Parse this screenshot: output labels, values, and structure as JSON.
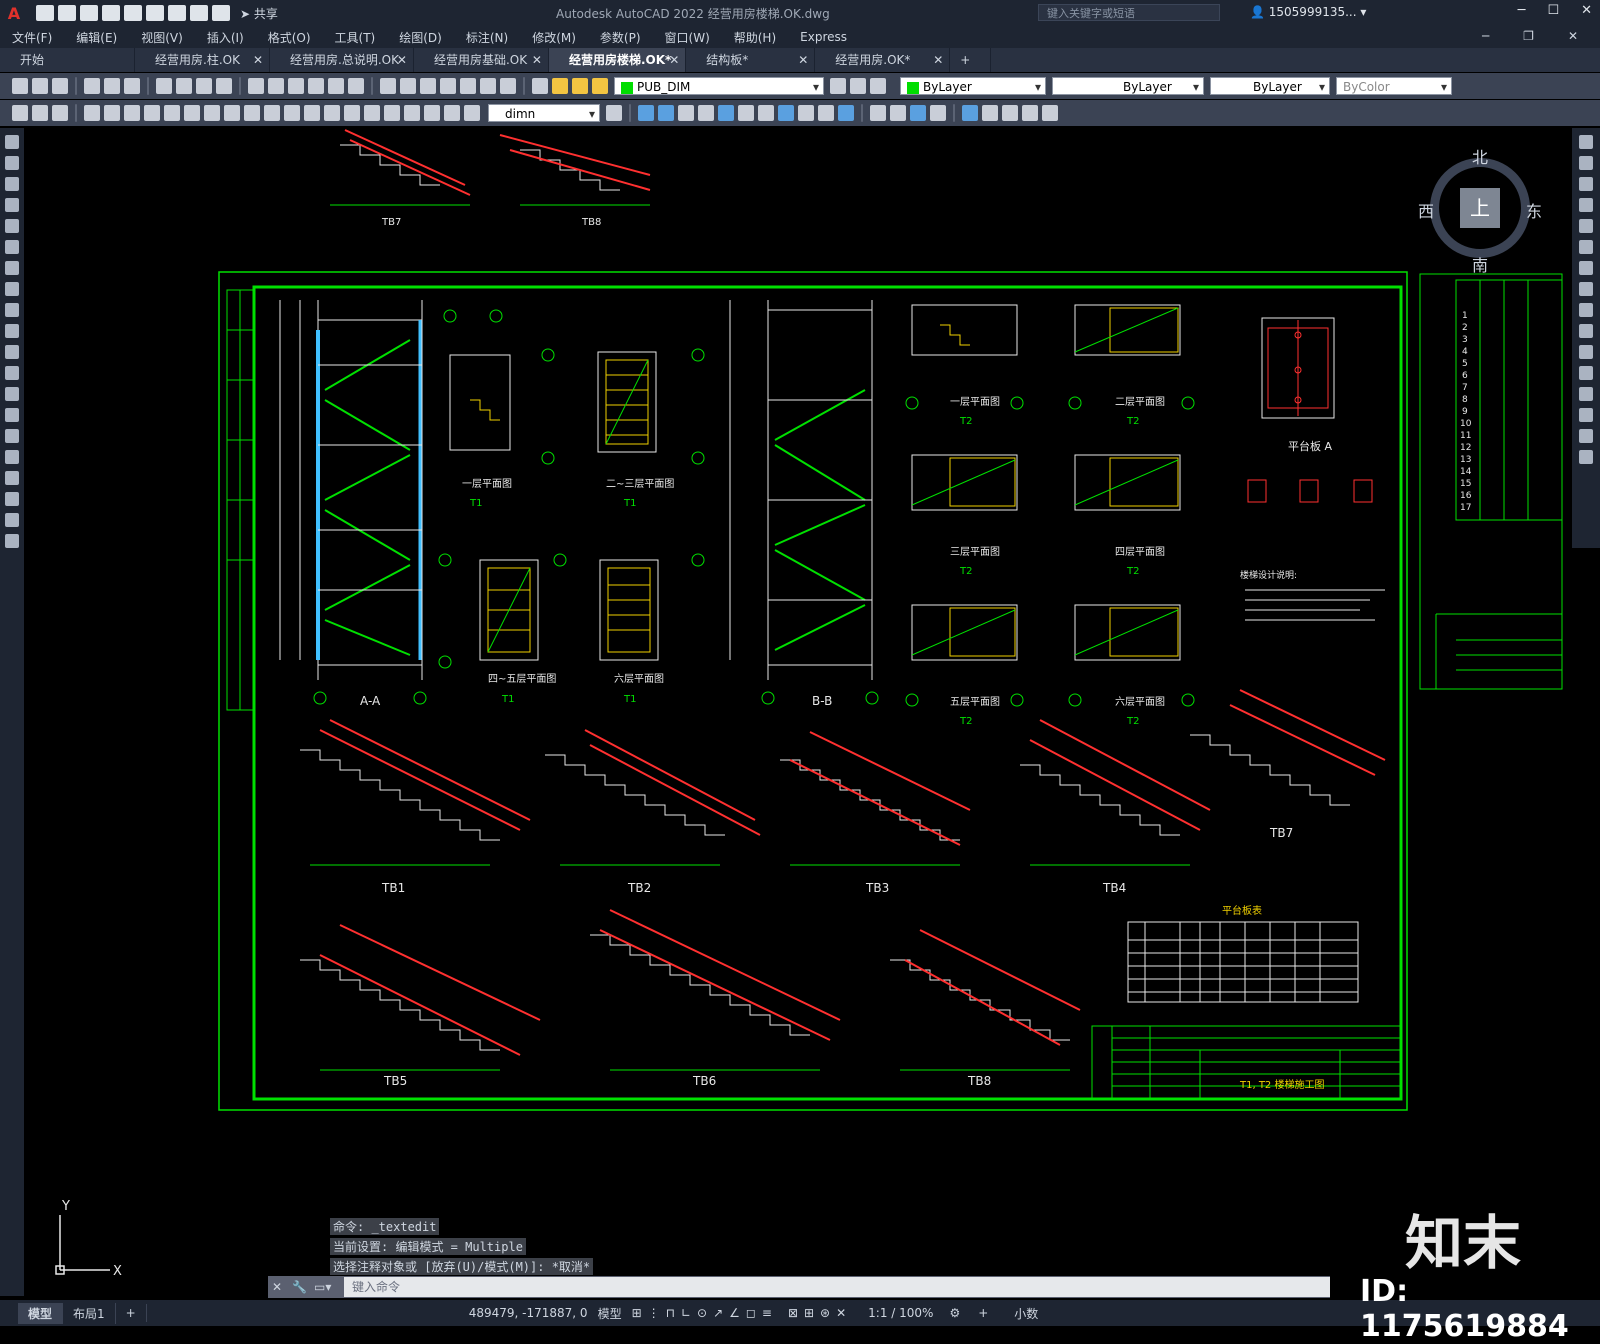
{
  "title_bar": {
    "app_logo": "A",
    "share_label": "共享",
    "app_title": "Autodesk AutoCAD 2022    经营用房楼梯.OK.dwg",
    "search_placeholder": "键入关键字或短语",
    "user_name": "1505999135..."
  },
  "menu": [
    "文件(F)",
    "编辑(E)",
    "视图(V)",
    "插入(I)",
    "格式(O)",
    "工具(T)",
    "绘图(D)",
    "标注(N)",
    "修改(M)",
    "参数(P)",
    "窗口(W)",
    "帮助(H)",
    "Express"
  ],
  "doc_tabs": [
    {
      "label": "开始",
      "closable": false,
      "active": false
    },
    {
      "label": "经营用房.柱.OK",
      "closable": true,
      "active": false
    },
    {
      "label": "经营用房.总说明.OK",
      "closable": true,
      "active": false
    },
    {
      "label": "经营用房基础.OK",
      "closable": true,
      "active": false
    },
    {
      "label": "经营用房楼梯.OK*",
      "closable": true,
      "active": true
    },
    {
      "label": "结构板*",
      "closable": true,
      "active": false
    },
    {
      "label": "经营用房.OK*",
      "closable": true,
      "active": false
    }
  ],
  "toolbar": {
    "layer": "PUB_DIM",
    "color": "ByLayer",
    "linetype": "ByLayer",
    "lineweight": "ByLayer",
    "plotstyle": "ByColor",
    "dimstyle": "dimn"
  },
  "viewcube": {
    "north": "北",
    "south": "南",
    "east": "东",
    "west": "西",
    "face": "上"
  },
  "drawing": {
    "section_labels": [
      "A-A",
      "B-B"
    ],
    "plan_labels": [
      "一层平面图",
      "二~三层平面图",
      "四~五层平面图",
      "六层平面图",
      "一层平面图",
      "二层平面图",
      "三层平面图",
      "四层平面图",
      "五层平面图",
      "六层平面图",
      "平台板 A"
    ],
    "plan_tags": [
      "T1",
      "T1",
      "T1",
      "T1",
      "T2",
      "T2",
      "T2",
      "T2",
      "T2",
      "T2"
    ],
    "stair_labels": [
      "TB1",
      "TB2",
      "TB3",
      "TB4",
      "TB5",
      "TB6",
      "TB7",
      "TB8",
      "TB7",
      "TB8"
    ],
    "table_title": "平台板表",
    "sheet_title": "T1, T2 楼梯施工图",
    "notes_title": "楼梯设计说明:",
    "index_rows": [
      "1",
      "2",
      "3",
      "4",
      "5",
      "6",
      "7",
      "8",
      "9",
      "10",
      "11",
      "12",
      "13",
      "14",
      "15",
      "16",
      "17"
    ]
  },
  "command_history": [
    "命令: _textedit",
    "当前设置: 编辑模式 = Multiple",
    "选择注释对象或 [放弃(U)/模式(M)]: *取消*"
  ],
  "command_placeholder": "键入命令",
  "layout_tabs": [
    "模型",
    "布局1"
  ],
  "status": {
    "coordinates": "489479, -171887, 0",
    "space": "模型",
    "scale": "1:1 / 100%",
    "units": "小数"
  },
  "watermark": {
    "logo": "知末",
    "id": "ID: 1175619884"
  }
}
